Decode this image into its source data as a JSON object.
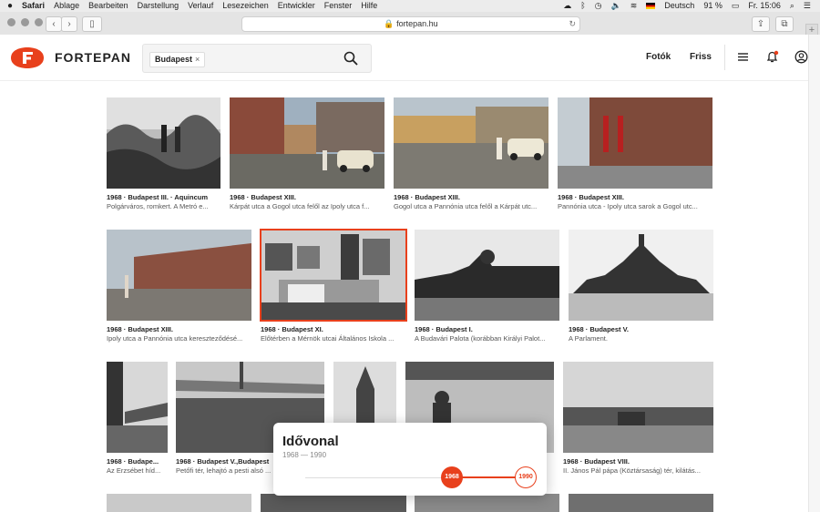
{
  "menubar": {
    "apple": "",
    "app": "Safari",
    "items": [
      "Ablage",
      "Bearbeiten",
      "Darstellung",
      "Verlauf",
      "Lesezeichen",
      "Entwickler",
      "Fenster",
      "Hilfe"
    ],
    "language": "Deutsch",
    "battery": "91 %",
    "clock": "Fr. 15:06"
  },
  "browser": {
    "url": "fortepan.hu",
    "reload": "↻"
  },
  "site": {
    "brand": "FORTEPAN",
    "search_chip": "Budapest",
    "chip_remove": "×",
    "nav_photos": "Fotók",
    "nav_new": "Friss"
  },
  "photos": [
    {
      "title": "1968 · Budapest III. · Aquincum",
      "desc": "Polgárváros, romkert. A Metró e..."
    },
    {
      "title": "1968 · Budapest XIII.",
      "desc": "Kárpát utca a Gogol utca felől az Ipoly utca f..."
    },
    {
      "title": "1968 · Budapest XIII.",
      "desc": "Gogol utca a Pannónia utca felől a Kárpát utc..."
    },
    {
      "title": "1968 · Budapest XIII.",
      "desc": "Pannónia utca - Ipoly utca sarok a Gogol utc..."
    },
    {
      "title": "1968 · Budapest XIII.",
      "desc": "Ipoly utca a Pannónia utca kereszteződésé..."
    },
    {
      "title": "1968 · Budapest XI.",
      "desc": "Előtérben a Mérnök utcai Általános Iskola ..."
    },
    {
      "title": "1968 · Budapest I.",
      "desc": "A Budavári Palota (korábban Királyi Palot..."
    },
    {
      "title": "1968 · Budapest V.",
      "desc": "A Parlament."
    },
    {
      "title": "1968 · Budape...",
      "desc": "Az Erzsébet híd..."
    },
    {
      "title": "1968 · Budapest V.,Budapest",
      "desc": "Petőfi tér, lehajtó a pesti alsó ..."
    },
    {
      "title": "",
      "desc": ""
    },
    {
      "title": "",
      "desc": ""
    },
    {
      "title": "1968 · Budapest VIII.",
      "desc": "II. János Pál pápa (Köztársaság) tér, kilátás..."
    }
  ],
  "timeline": {
    "title": "Idővonal",
    "range": "1968 — 1990",
    "start": "1968",
    "end": "1990"
  }
}
